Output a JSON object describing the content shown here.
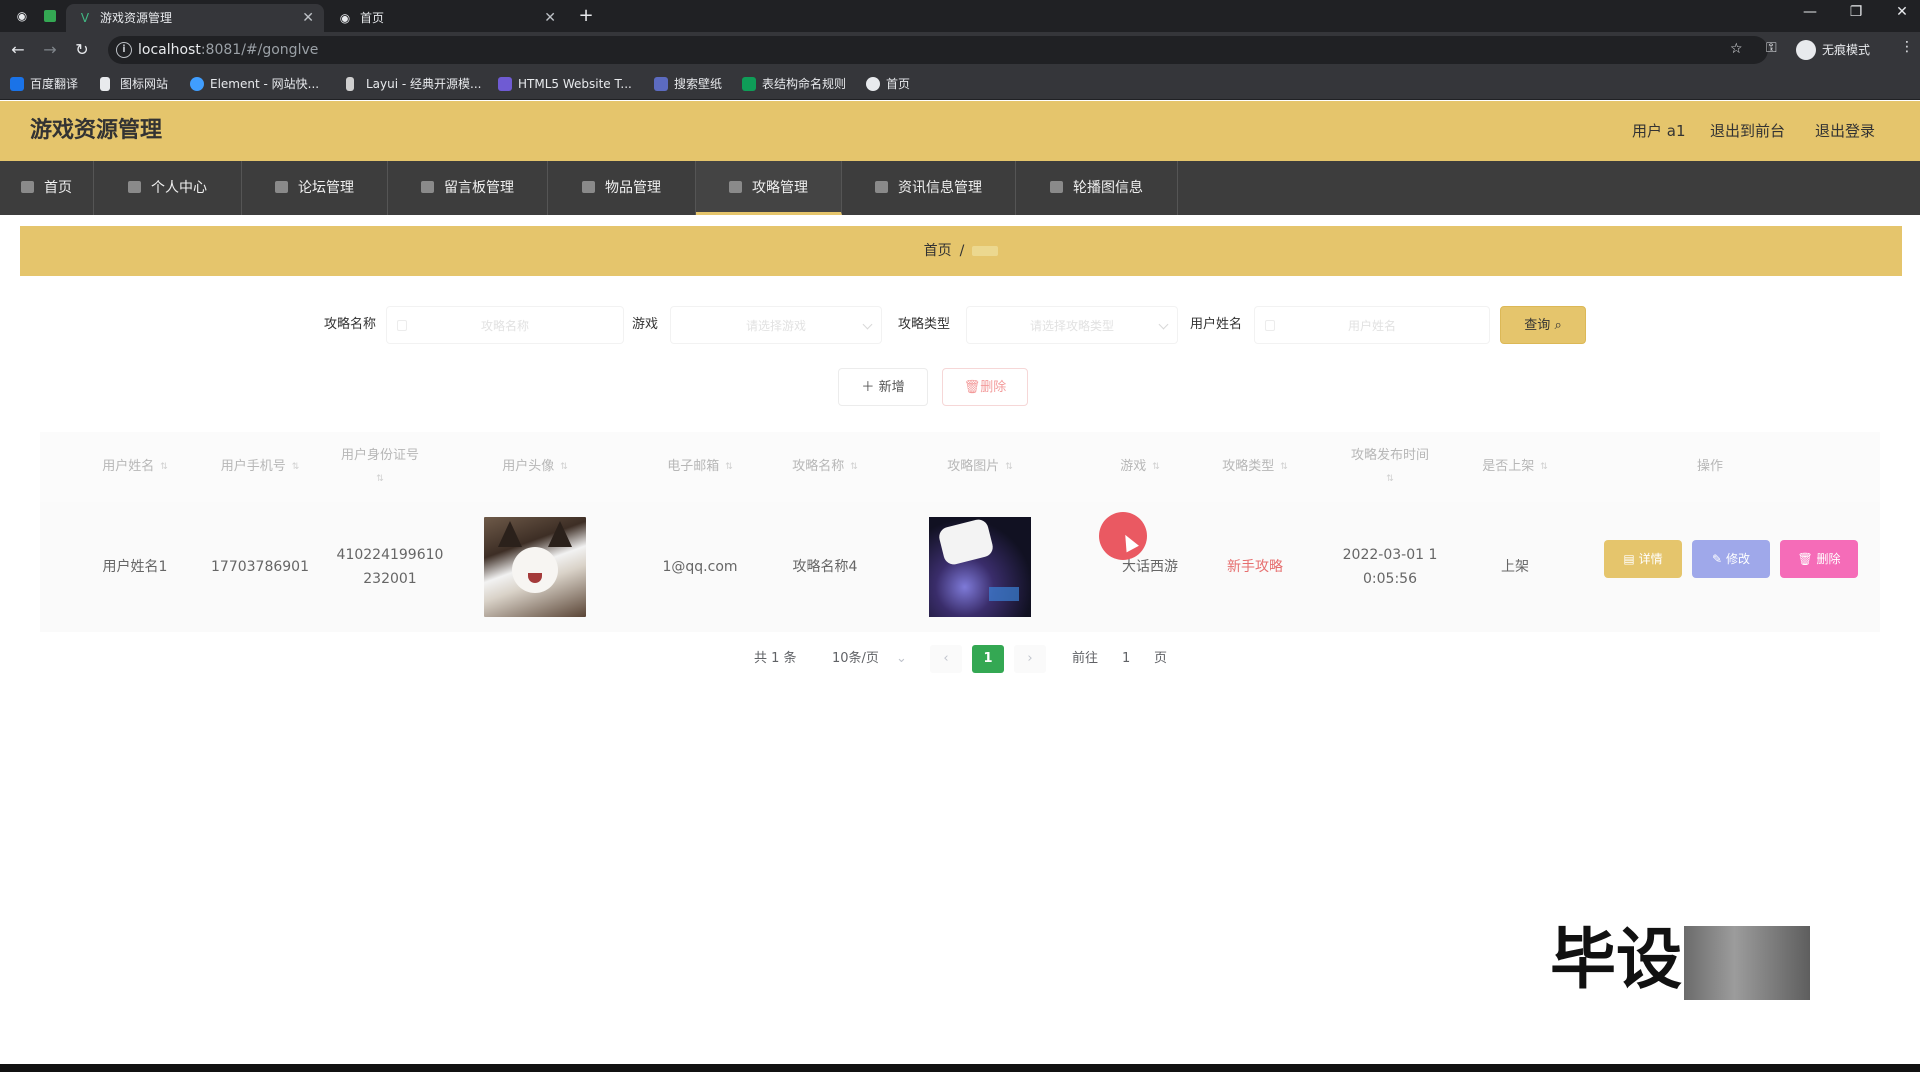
{
  "browser": {
    "tabs": [
      {
        "title": "游戏资源管理",
        "active": true
      },
      {
        "title": "首页",
        "active": false
      }
    ],
    "url_host": "localhost",
    "url_rest": ":8081/#/gonglve",
    "profile_label": "无痕模式",
    "bookmarks": [
      "百度翻译",
      "图标网站",
      "Element - 网站快...",
      "Layui - 经典开源模...",
      "HTML5 Website T...",
      "搜索壁纸",
      "表结构命名规则",
      "首页"
    ]
  },
  "header": {
    "title": "游戏资源管理",
    "user_label": "用户 a1",
    "front_link": "退出到前台",
    "logout_link": "退出登录"
  },
  "menu": {
    "items": [
      "首页",
      "个人中心",
      "论坛管理",
      "留言板管理",
      "物品管理",
      "攻略管理",
      "资讯信息管理",
      "轮播图信息"
    ],
    "active_index": 5
  },
  "breadcrumb": {
    "home": "首页",
    "separator": "/"
  },
  "search": {
    "name_label": "攻略名称",
    "name_placeholder": "攻略名称",
    "game_label": "游戏",
    "game_placeholder": "请选择游戏",
    "type_label": "攻略类型",
    "type_placeholder": "请选择攻略类型",
    "user_label": "用户姓名",
    "user_placeholder": "用户姓名",
    "query_button": "查询"
  },
  "actions": {
    "add_button": "新增",
    "delete_button": "删除"
  },
  "table": {
    "headers": [
      "用户姓名",
      "用户手机号",
      "用户身份证号",
      "用户头像",
      "电子邮箱",
      "攻略名称",
      "攻略图片",
      "游戏",
      "攻略类型",
      "攻略发布时间",
      "是否上架",
      "操作"
    ],
    "rows": [
      {
        "user_name": "用户姓名1",
        "phone": "17703786901",
        "id_card_line1": "410224199610",
        "id_card_line2": "232001",
        "email": "1@qq.com",
        "guide_name": "攻略名称4",
        "game": "大话西游",
        "guide_type": "新手攻略",
        "publish_line1": "2022-03-01 1",
        "publish_line2": "0:05:56",
        "on_shelf": "上架"
      }
    ],
    "row_buttons": {
      "detail": "详情",
      "edit": "修改",
      "delete": "删除"
    }
  },
  "pagination": {
    "total": "共 1 条",
    "page_size": "10条/页",
    "current_page": "1",
    "goto_prefix": "前往",
    "goto_value": "1",
    "goto_suffix": "页"
  },
  "watermark": "毕设",
  "colors": {
    "theme": "#e5c56c",
    "menu_bg": "#3d3d3d",
    "edit_btn": "#9fa8ea",
    "delete_btn": "#f56cb8",
    "page_active": "#34a853"
  }
}
